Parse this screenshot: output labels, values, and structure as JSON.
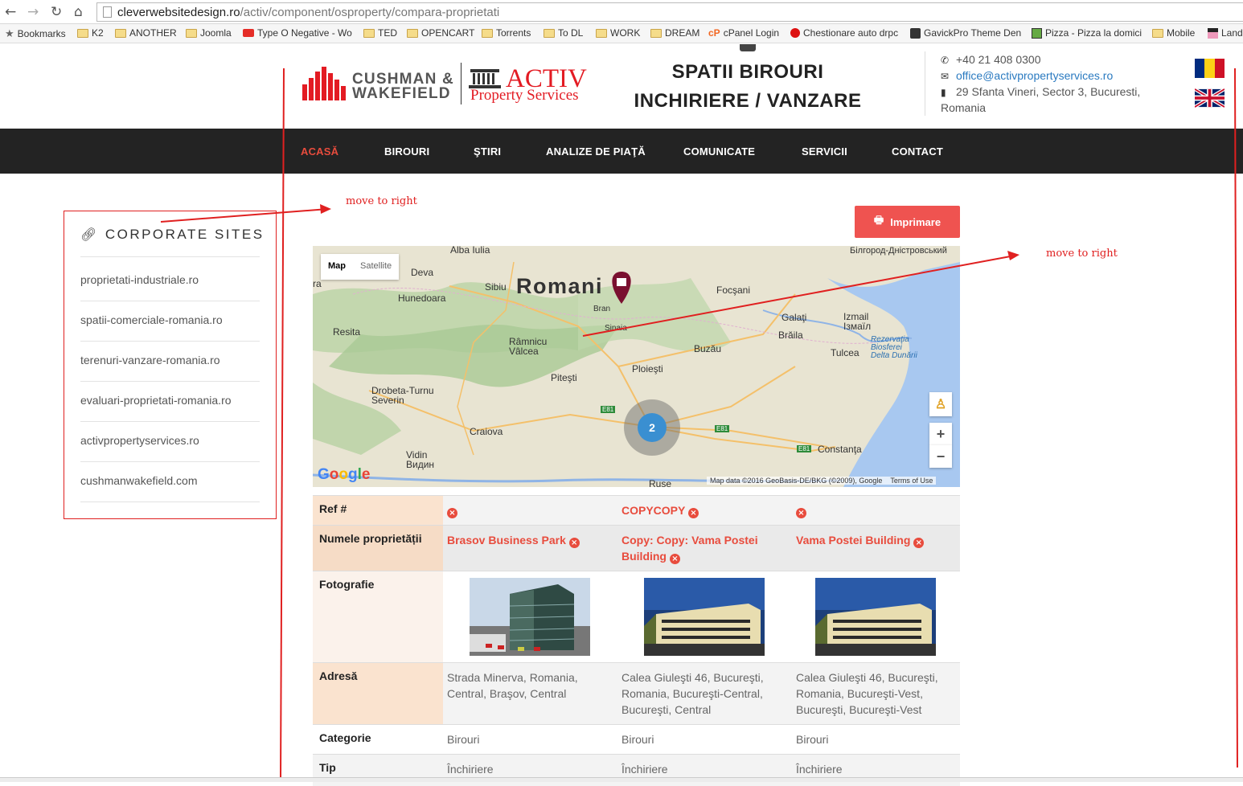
{
  "browser": {
    "url_host": "cleverwebsitedesign.ro",
    "url_path": "/activ/component/osproperty/compara-proprietati",
    "bookmarks": [
      "Bookmarks",
      "K2",
      "ANOTHER",
      "Joomla",
      "Type O Negative - Wo",
      "TED",
      "OPENCART",
      "Torrents",
      "To DL",
      "WORK",
      "DREAM",
      "cPanel Login",
      "Chestionare auto drpc",
      "GavickPro Theme Den",
      "Pizza - Pizza la domici",
      "Mobile",
      "Land"
    ]
  },
  "header": {
    "cw_line1": "CUSHMAN &",
    "cw_line2": "WAKEFIELD",
    "activ_title": "ACTIV",
    "activ_sub": "Property Services",
    "title_line1": "SPATII BIROURI",
    "title_line2": "INCHIRIERE / VANZARE",
    "phone": "+40 21 408 0300",
    "email": "office@activpropertyservices.ro",
    "address1": "29 Sfanta Vineri, Sector 3, Bucuresti,",
    "address2": "Romania"
  },
  "nav": [
    "ACASĂ",
    "BIROURI",
    "ŞTIRI",
    "ANALIZE DE PIAŢĂ",
    "COMUNICATE",
    "SERVICII",
    "CONTACT"
  ],
  "sidebar": {
    "title": "CORPORATE SITES",
    "links": [
      "proprietati-industriale.ro",
      "spatii-comerciale-romania.ro",
      "terenuri-vanzare-romania.ro",
      "evaluari-proprietati-romania.ro",
      "activpropertyservices.ro",
      "cushmanwakefield.com"
    ]
  },
  "annotations": [
    "move to right",
    "move to right"
  ],
  "print_button": "Imprimare",
  "map": {
    "tab_map": "Map",
    "tab_satellite": "Satellite",
    "cluster_count": "2",
    "attribution": "Map data ©2016 GeoBasis-DE/BKG (©2009), Google",
    "terms": "Terms of Use",
    "labels": [
      "Alba Iulia",
      "Deva",
      "Hunedoara",
      "Sibiu",
      "Romani",
      "Bran",
      "Sinaia",
      "Focşani",
      "Galaţi",
      "Brăila",
      "Izmail\nІзмаїл",
      "Білгород-Дністровський",
      "Resita",
      "Râmnicu\nVâlcea",
      "Buzău",
      "Tulcea",
      "Rezervaţia\nBiosferei\nDelta Dunării",
      "Piteşti",
      "Ploieşti",
      "Drobeta-Turnu\nSeverin",
      "Craiova",
      "Constanţa",
      "Vidin\nВидин",
      "Ruse",
      "ra",
      "E81",
      "E81",
      "E81"
    ]
  },
  "comparison": {
    "rows": [
      {
        "label": "Ref #",
        "cells": [
          "",
          "COPYCOPY",
          ""
        ]
      },
      {
        "label": "Numele proprietății",
        "cells": [
          "Brasov Business Park",
          "Copy: Copy: Vama Postei Building",
          "Vama Postei Building"
        ]
      },
      {
        "label": "Fotografie",
        "cells": [
          "",
          "",
          ""
        ]
      },
      {
        "label": "Adresă",
        "cells": [
          "Strada Minerva, Romania, Central, Braşov, Central",
          "Calea Giuleşti 46, Bucureşti, Romania, Bucureşti-Central, Bucureşti, Central",
          "Calea Giuleşti 46, Bucureşti, Romania, Bucureşti-Vest, Bucureşti, Bucureşti-Vest"
        ]
      },
      {
        "label": "Categorie",
        "cells": [
          "Birouri",
          "Birouri",
          "Birouri"
        ]
      },
      {
        "label": "Tip",
        "cells": [
          "Închiriere",
          "Închiriere",
          "Închiriere"
        ]
      }
    ]
  },
  "colors": {
    "accent": "#e84c3d",
    "nav_bg": "#232323",
    "annotation": "#e02020",
    "label_bg": "#fae3cf"
  }
}
